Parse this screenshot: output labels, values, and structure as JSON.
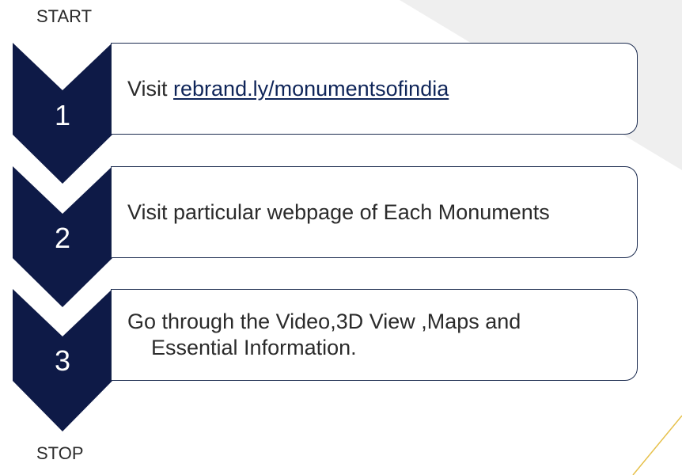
{
  "start_label": "START",
  "stop_label": "STOP",
  "steps": [
    {
      "number": "1",
      "text_prefix": "Visit ",
      "link_text": "rebrand.ly/monumentsofindia"
    },
    {
      "number": "2",
      "text": "Visit particular webpage of Each Monuments"
    },
    {
      "number": "3",
      "text_line1": "Go through the Video,3D View ,Maps and",
      "text_line2": "Essential Information."
    }
  ],
  "colors": {
    "chevron_navy": "#0e1a47",
    "box_border": "#1b2b4f",
    "accent_gold": "#e6c04a",
    "corner_gray": "#efefef"
  }
}
